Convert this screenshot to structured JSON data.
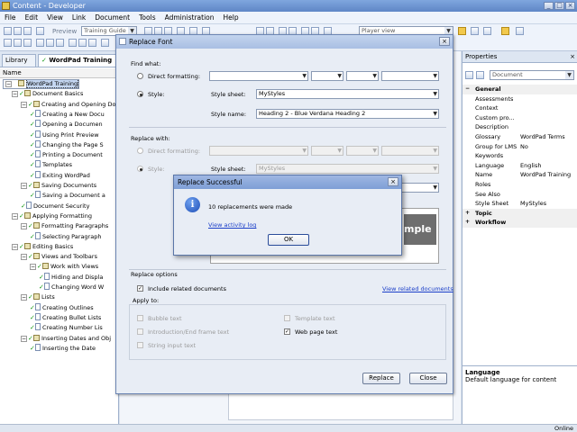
{
  "app": {
    "title": "Content - Developer"
  },
  "menu": [
    "File",
    "Edit",
    "View",
    "Link",
    "Document",
    "Tools",
    "Administration",
    "Help"
  ],
  "toolbar": {
    "preview_label": "Preview",
    "training_combo": "Training Guide",
    "player_combo": "Player view"
  },
  "left_panel": {
    "tabs": [
      "Library",
      "WordPad Training"
    ],
    "column_header": "Name",
    "tree": [
      {
        "label": "WordPad Training",
        "level": 0,
        "kind": "book",
        "checked": false,
        "selected": true
      },
      {
        "label": "Document Basics",
        "level": 1,
        "kind": "book",
        "checked": true
      },
      {
        "label": "Creating and Opening Do",
        "level": 2,
        "kind": "book",
        "checked": true
      },
      {
        "label": "Creating a New Docu",
        "level": 3,
        "kind": "doc",
        "checked": true
      },
      {
        "label": "Opening a Documen",
        "level": 3,
        "kind": "doc",
        "checked": true
      },
      {
        "label": "Using Print Preview",
        "level": 3,
        "kind": "doc",
        "checked": true
      },
      {
        "label": "Changing the Page S",
        "level": 3,
        "kind": "doc",
        "checked": true
      },
      {
        "label": "Printing a Document",
        "level": 3,
        "kind": "doc",
        "checked": true
      },
      {
        "label": "Templates",
        "level": 3,
        "kind": "doc",
        "checked": true
      },
      {
        "label": "Exiting WordPad",
        "level": 3,
        "kind": "doc",
        "checked": true
      },
      {
        "label": "Saving Documents",
        "level": 2,
        "kind": "book",
        "checked": true
      },
      {
        "label": "Saving a Document a",
        "level": 3,
        "kind": "doc",
        "checked": true
      },
      {
        "label": "Document Security",
        "level": 2,
        "kind": "doc",
        "checked": true
      },
      {
        "label": "Applying Formatting",
        "level": 1,
        "kind": "book",
        "checked": true
      },
      {
        "label": "Formatting Paragraphs",
        "level": 2,
        "kind": "book",
        "checked": true
      },
      {
        "label": "Selecting Paragraph",
        "level": 3,
        "kind": "doc",
        "checked": true
      },
      {
        "label": "Editing Basics",
        "level": 1,
        "kind": "book",
        "checked": true
      },
      {
        "label": "Views and Toolbars",
        "level": 2,
        "kind": "book",
        "checked": true
      },
      {
        "label": "Work with Views",
        "level": 3,
        "kind": "book",
        "checked": true
      },
      {
        "label": "Hiding and Displa",
        "level": 4,
        "kind": "doc",
        "checked": true
      },
      {
        "label": "Changing Word W",
        "level": 4,
        "kind": "doc",
        "checked": true
      },
      {
        "label": "Lists",
        "level": 2,
        "kind": "book",
        "checked": true
      },
      {
        "label": "Creating Outlines",
        "level": 3,
        "kind": "doc",
        "checked": true
      },
      {
        "label": "Creating Bullet Lists",
        "level": 3,
        "kind": "doc",
        "checked": true
      },
      {
        "label": "Creating Number Lis",
        "level": 3,
        "kind": "doc",
        "checked": true
      },
      {
        "label": "Inserting Dates and Obj",
        "level": 2,
        "kind": "book",
        "checked": true
      },
      {
        "label": "Inserting the Date",
        "level": 3,
        "kind": "doc",
        "checked": true
      }
    ]
  },
  "properties": {
    "title": "Properties",
    "object_combo": "Document",
    "rows": [
      {
        "type": "cat",
        "key": "General",
        "expanded": true
      },
      {
        "type": "row",
        "key": "Assessments",
        "value": ""
      },
      {
        "type": "row",
        "key": "Context",
        "value": ""
      },
      {
        "type": "row",
        "key": "Custom pro...",
        "value": ""
      },
      {
        "type": "row",
        "key": "Description",
        "value": ""
      },
      {
        "type": "row",
        "key": "Glossary",
        "value": "WordPad Terms"
      },
      {
        "type": "row",
        "key": "Group for LMS",
        "value": "No"
      },
      {
        "type": "row",
        "key": "Keywords",
        "value": ""
      },
      {
        "type": "row",
        "key": "Language",
        "value": "English"
      },
      {
        "type": "row",
        "key": "Name",
        "value": "WordPad Training"
      },
      {
        "type": "row",
        "key": "Roles",
        "value": ""
      },
      {
        "type": "row",
        "key": "See Also",
        "value": ""
      },
      {
        "type": "row",
        "key": "Style Sheet",
        "value": "MyStyles"
      },
      {
        "type": "cat",
        "key": "Topic",
        "expanded": false
      },
      {
        "type": "cat",
        "key": "Workflow",
        "expanded": false
      }
    ],
    "desc_title": "Language",
    "desc_text": "Default language for content"
  },
  "status": {
    "online": "Online"
  },
  "replace_font": {
    "title": "Replace Font",
    "find_what": "Find what:",
    "direct_formatting": "Direct formatting:",
    "style": "Style:",
    "style_sheet_label": "Style sheet:",
    "style_name_label": "Style name:",
    "find_style_sheet": "MyStyles",
    "find_style_name": "Heading 2 - Blue Verdana Heading 2",
    "replace_with": "Replace with:",
    "replace_style_sheet": "MyStyles",
    "preview_text": "mple",
    "replace_options": "Replace options",
    "include_related": "Include related documents",
    "view_related": "View related documents",
    "apply_to": "Apply to:",
    "apply_items": {
      "bubble": "Bubble text",
      "intro": "Introduction/End frame text",
      "string": "String input text",
      "template": "Template text",
      "web": "Web page text"
    },
    "replace_btn": "Replace",
    "close_btn": "Close"
  },
  "msgbox": {
    "title": "Replace Successful",
    "message": "10 replacements were made",
    "link": "View activity log",
    "ok": "OK"
  }
}
